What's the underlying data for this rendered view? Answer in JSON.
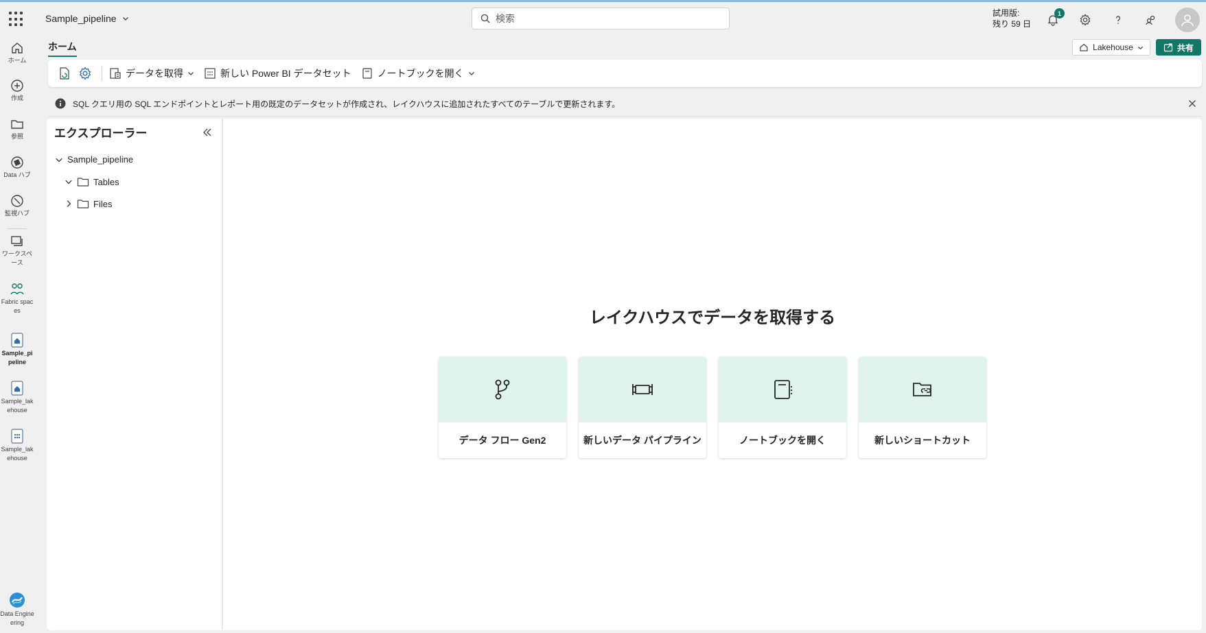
{
  "header": {
    "app_title": "Sample_pipeline",
    "search_placeholder": "検索",
    "trial_line1": "試用版:",
    "trial_line2": "残り 59 日",
    "notification_count": "1"
  },
  "rail": {
    "items": [
      {
        "label": "ホーム",
        "icon": "home-icon"
      },
      {
        "label": "作成",
        "icon": "create-icon"
      },
      {
        "label": "参照",
        "icon": "browse-icon"
      },
      {
        "label": "Data ハブ",
        "icon": "data-hub-icon"
      },
      {
        "label": "監視ハブ",
        "icon": "monitor-hub-icon"
      },
      {
        "label": "ワークスペース",
        "icon": "workspaces-icon"
      },
      {
        "label": "Fabric spaces",
        "icon": "fabric-spaces-icon"
      },
      {
        "label": "Sample_pipeline",
        "icon": "lakehouse-item-icon"
      },
      {
        "label": "Sample_lakehouse",
        "icon": "lakehouse-item-icon"
      },
      {
        "label": "Sample_lakehouse",
        "icon": "dataset-item-icon"
      },
      {
        "label": "Data Engineering",
        "icon": "data-engineering-icon"
      }
    ]
  },
  "ribbon": {
    "tab_home": "ホーム",
    "lakehouse_label": "Lakehouse",
    "share_label": "共有",
    "get_data": "データを取得",
    "new_dataset": "新しい Power BI データセット",
    "open_notebook": "ノートブックを開く"
  },
  "infobar": {
    "message": "SQL クエリ用の SQL エンドポイントとレポート用の既定のデータセットが作成され、レイクハウスに追加されたすべてのテーブルで更新されます。"
  },
  "explorer": {
    "title": "エクスプローラー",
    "root": "Sample_pipeline",
    "tables": "Tables",
    "files": "Files"
  },
  "main": {
    "title": "レイクハウスでデータを取得する",
    "cards": [
      {
        "label": "データ フロー Gen2",
        "icon": "dataflow-icon"
      },
      {
        "label": "新しいデータ パイプライン",
        "icon": "pipeline-icon"
      },
      {
        "label": "ノートブックを開く",
        "icon": "notebook-icon"
      },
      {
        "label": "新しいショートカット",
        "icon": "shortcut-icon"
      }
    ]
  },
  "colors": {
    "accent": "#117865",
    "card_top": "#e0f4ee",
    "background": "#f0f0f0"
  }
}
